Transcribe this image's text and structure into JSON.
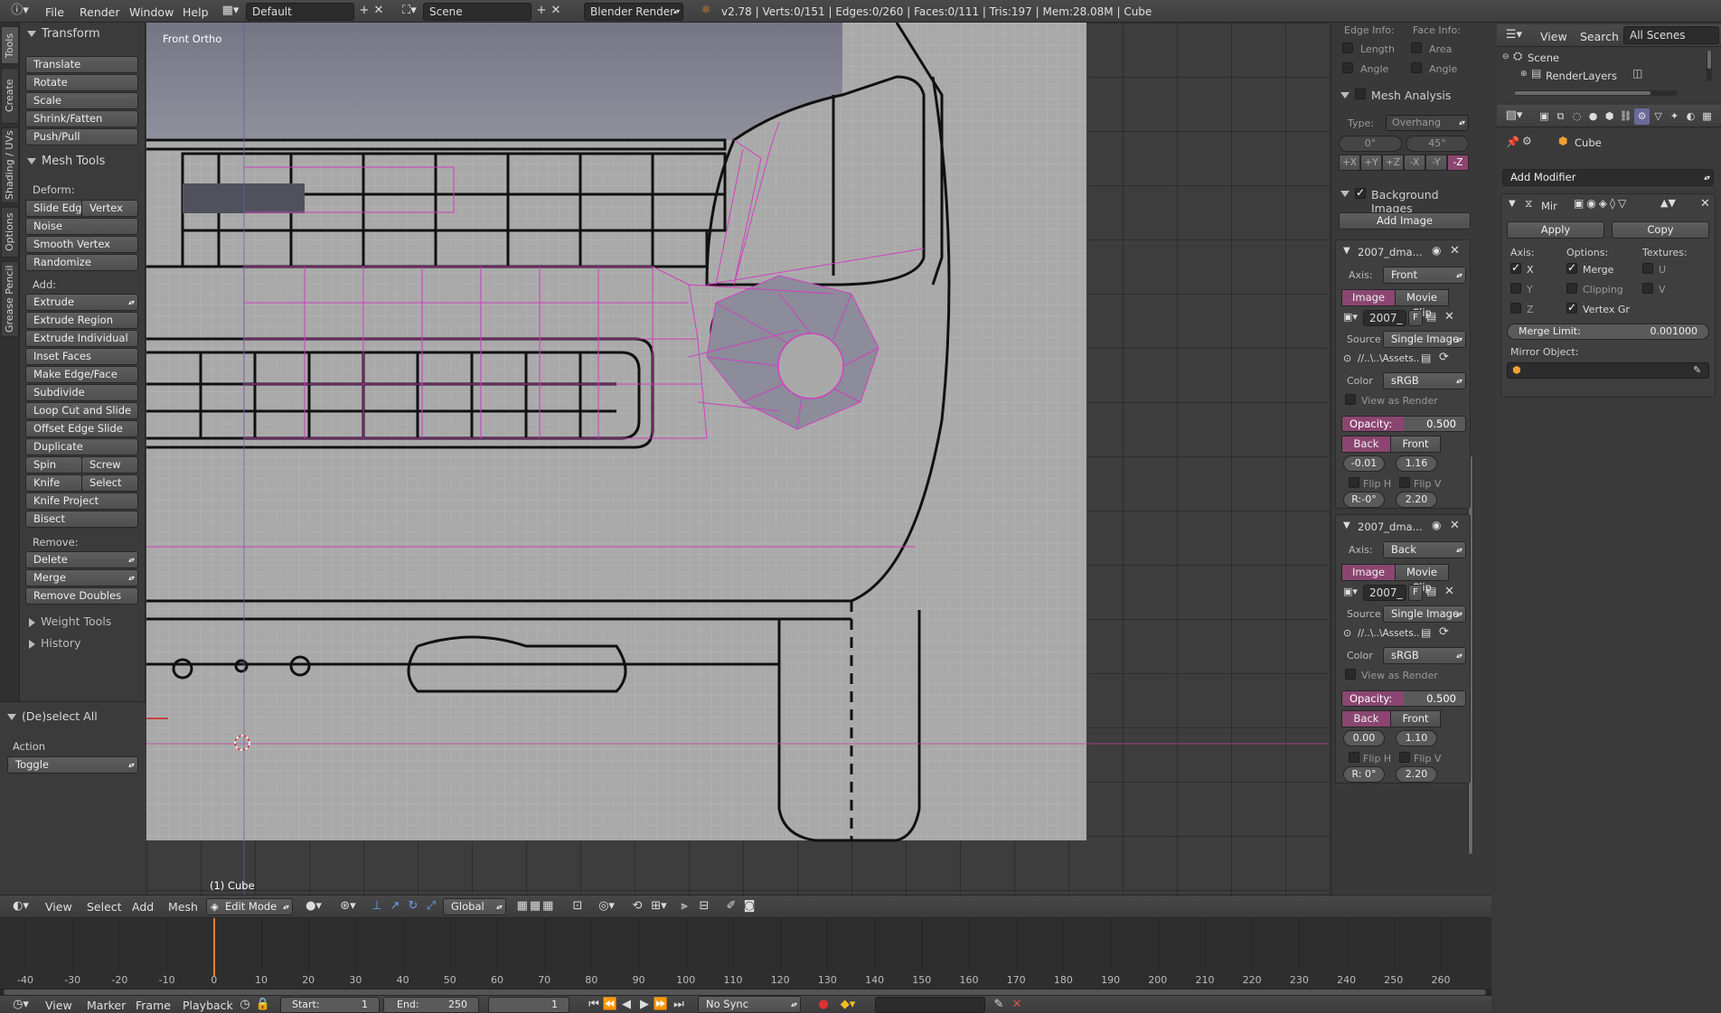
{
  "topbar": {
    "menus": [
      "File",
      "Render",
      "Window",
      "Help"
    ],
    "screen_layout": "Default",
    "scene": "Scene",
    "render_engine": "Blender Render",
    "stats": "v2.78 | Verts:0/151 | Edges:0/260 | Faces:0/111 | Tris:197 | Mem:28.08M | Cube"
  },
  "tabs": [
    "Tools",
    "Create",
    "Shading / UVs",
    "Options",
    "Grease Pencil"
  ],
  "toolshelf": {
    "transform_title": "Transform",
    "transform": [
      "Translate",
      "Rotate",
      "Scale",
      "Shrink/Fatten",
      "Push/Pull"
    ],
    "mesh_tools_title": "Mesh Tools",
    "deform_label": "Deform:",
    "slide_edge": "Slide Edge",
    "vertex": "Vertex",
    "deform": [
      "Noise",
      "Smooth Vertex",
      "Randomize"
    ],
    "add_label": "Add:",
    "extrude": "Extrude",
    "add": [
      "Extrude Region",
      "Extrude Individual",
      "Inset Faces",
      "Make Edge/Face",
      "Subdivide",
      "Loop Cut and Slide",
      "Offset Edge Slide",
      "Duplicate"
    ],
    "spin": "Spin",
    "screw": "Screw",
    "knife": "Knife",
    "select": "Select",
    "knife_project": "Knife Project",
    "bisect": "Bisect",
    "remove_label": "Remove:",
    "delete": "Delete",
    "merge": "Merge",
    "remove_doubles": "Remove Doubles",
    "weight_tools": "Weight Tools",
    "history": "History",
    "operator_title": "(De)select All",
    "action_label": "Action",
    "action_value": "Toggle"
  },
  "viewport": {
    "view_name": "Front Ortho",
    "object_label": "(1) Cube"
  },
  "npanel": {
    "edge_info": "Edge Info:",
    "face_info": "Face Info:",
    "length": "Length",
    "area": "Area",
    "angle1": "Angle",
    "angle2": "Angle",
    "mesh_analysis": "Mesh Analysis",
    "type_label": "Type:",
    "type_value": "Overhang",
    "angle_min": "0°",
    "angle_max": "45°",
    "axes": [
      "+X",
      "+Y",
      "+Z",
      "-X",
      "-Y",
      "-Z"
    ],
    "background_images": "Background Images",
    "add_image": "Add Image",
    "images": [
      {
        "name": "2007_dma...",
        "axis_label": "Axis:",
        "axis": "Front",
        "image_tab": "Image",
        "clip_tab": "Movie Clip",
        "file": "2007_",
        "f": "F",
        "source_label": "Source",
        "source": "Single Image",
        "path": "//..\\..\\Assets...",
        "color_label": "Color",
        "color": "sRGB",
        "view_as_render": "View as Render",
        "opacity_label": "Opacity:",
        "opacity": "0.500",
        "opacity_value": 0.5,
        "back": "Back",
        "front": "Front",
        "x": "-0.01",
        "y": "1.16",
        "flip_h": "Flip H",
        "flip_v": "Flip V",
        "rot": "R:-0°",
        "size": "2.20"
      },
      {
        "name": "2007_dma...",
        "axis_label": "Axis:",
        "axis": "Back",
        "image_tab": "Image",
        "clip_tab": "Movie Clip",
        "file": "2007_",
        "f": "F",
        "source_label": "Source",
        "source": "Single Image",
        "path": "//..\\..\\Assets...",
        "color_label": "Color",
        "color": "sRGB",
        "view_as_render": "View as Render",
        "opacity_label": "Opacity:",
        "opacity": "0.500",
        "opacity_value": 0.5,
        "back": "Back",
        "front": "Front",
        "x": "0.00",
        "y": "1.10",
        "flip_h": "Flip H",
        "flip_v": "Flip V",
        "rot": "R: 0°",
        "size": "2.20"
      }
    ]
  },
  "outliner": {
    "view": "View",
    "search": "Search",
    "filter": "All Scenes",
    "scene": "Scene",
    "render_layers": "RenderLayers"
  },
  "properties": {
    "object": "Cube",
    "add_modifier": "Add Modifier",
    "modifier_name": "Mir",
    "apply": "Apply",
    "copy": "Copy",
    "axis_label": "Axis:",
    "options_label": "Options:",
    "textures_label": "Textures:",
    "x": "X",
    "y": "Y",
    "z": "Z",
    "merge": "Merge",
    "clipping": "Clipping",
    "vertex_groups": "Vertex Gr",
    "u": "U",
    "v": "V",
    "merge_limit_label": "Merge Limit:",
    "merge_limit": "0.001000",
    "mirror_object": "Mirror Object:"
  },
  "view3d_header": {
    "menus": [
      "View",
      "Select",
      "Add",
      "Mesh"
    ],
    "mode": "Edit Mode",
    "orientation": "Global"
  },
  "timeline": {
    "ticks": [
      -40,
      -30,
      -20,
      -10,
      0,
      10,
      20,
      30,
      40,
      50,
      60,
      70,
      80,
      90,
      100,
      110,
      120,
      130,
      140,
      150,
      160,
      170,
      180,
      190,
      200,
      210,
      220,
      230,
      240,
      250,
      260
    ],
    "current_frame": 0
  },
  "footer": {
    "menus": [
      "View",
      "Marker",
      "Frame",
      "Playback"
    ],
    "start_label": "Start:",
    "start": "1",
    "end_label": "End:",
    "end": "250",
    "frame": "1",
    "sync": "No Sync"
  },
  "colors": {
    "accent": "#8a4670",
    "wire": "#d040c0",
    "frame_marker": "#e87d20"
  }
}
